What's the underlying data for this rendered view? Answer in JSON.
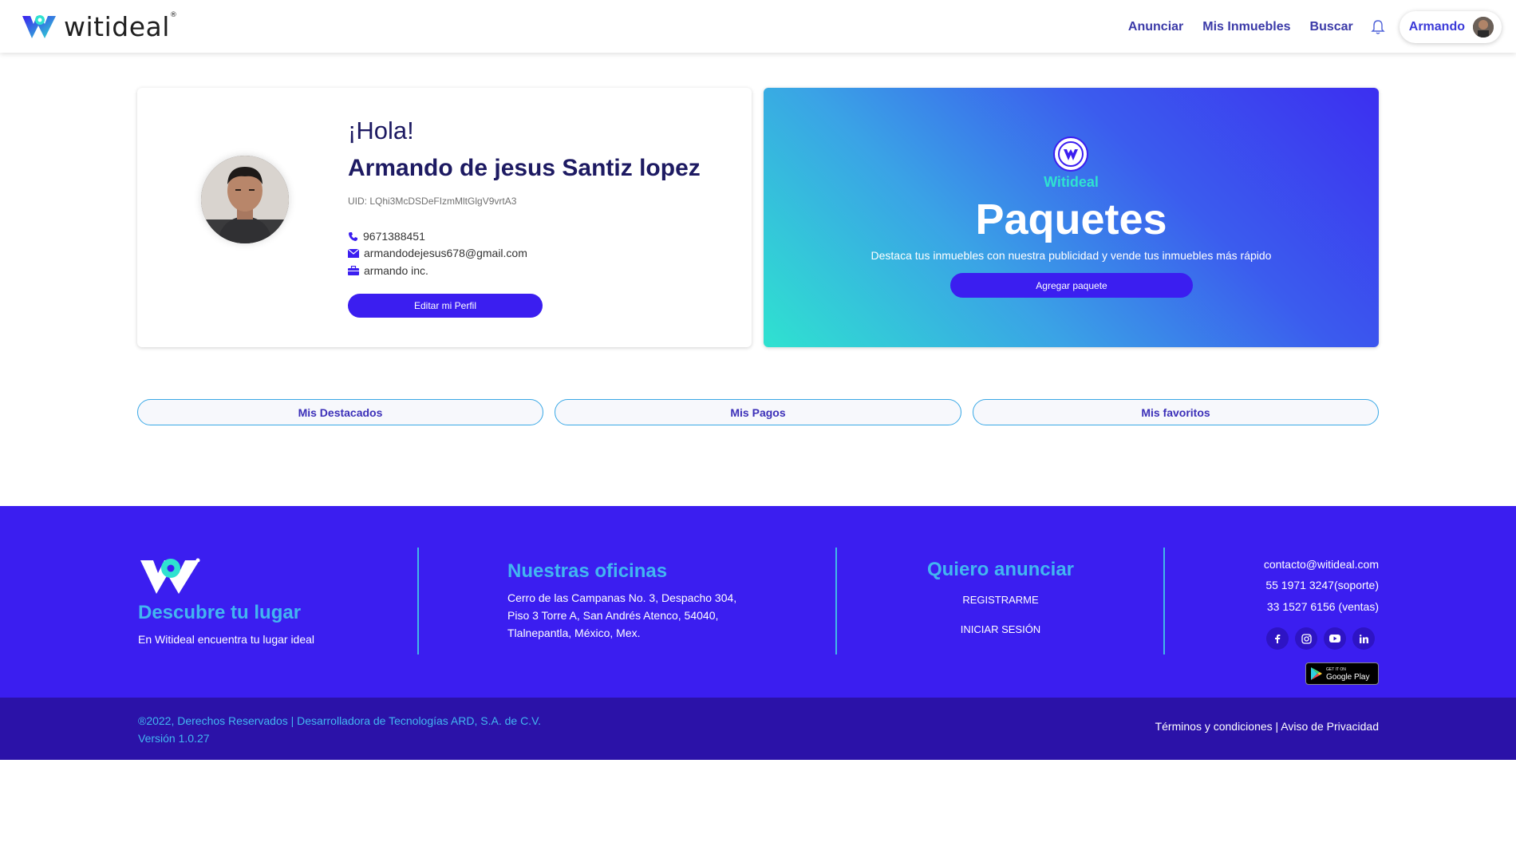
{
  "header": {
    "brand": "witideal",
    "brand_mark": "®",
    "nav": [
      "Anunciar",
      "Mis Inmuebles",
      "Buscar"
    ],
    "user_name": "Armando"
  },
  "profile": {
    "greeting": "¡Hola!",
    "full_name": "Armando de jesus Santiz lopez",
    "uid": "UID: LQhi3McDSDeFIzmMltGlgV9vrtA3",
    "phone": "9671388451",
    "email": "armandodejesus678@gmail.com",
    "company": "armando inc.",
    "edit_button": "Editar mi Perfil"
  },
  "packages": {
    "brand": "Witideal",
    "title": "Paquetes",
    "description": "Destaca tus inmuebles con nuestra publicidad y vende tus inmuebles más rápido",
    "button": "Agregar paquete"
  },
  "tabs": [
    "Mis Destacados",
    "Mis Pagos",
    "Mis favoritos"
  ],
  "footer": {
    "tagline_title": "Descubre tu lugar",
    "tagline_text": "En Witideal encuentra tu lugar ideal",
    "offices_title": "Nuestras oficinas",
    "offices_lines": [
      "Cerro de las Campanas No. 3, Despacho 304,",
      "Piso 3 Torre A, San Andrés Atenco, 54040,",
      "Tlalnepantla, México, Mex."
    ],
    "advertise_title": "Quiero anunciar",
    "register_link": "REGISTRARME",
    "login_link": "INICIAR SESIÓN",
    "contact_email": "contacto@witideal.com",
    "support_phone": "55 1971 3247(soporte)",
    "sales_phone": "33 1527 6156 (ventas)",
    "social_icons": [
      "facebook-icon",
      "instagram-icon",
      "youtube-icon",
      "linkedin-icon"
    ],
    "store_badge_small": "GET IT ON",
    "store_badge": "Google Play",
    "copyright": "®2022, Derechos Reservados | Desarrolladora de Tecnologías ARD, S.A. de C.V.",
    "version": "Versión 1.0.27",
    "legal": "Términos y condiciones | Aviso de Privacidad"
  },
  "colors": {
    "accent": "#3b1ef0",
    "footer_bg": "#3b1ef0",
    "footer_bottom_bg": "#2b12a8",
    "highlight": "#42b6f0",
    "dark_text": "#1d1a62"
  }
}
